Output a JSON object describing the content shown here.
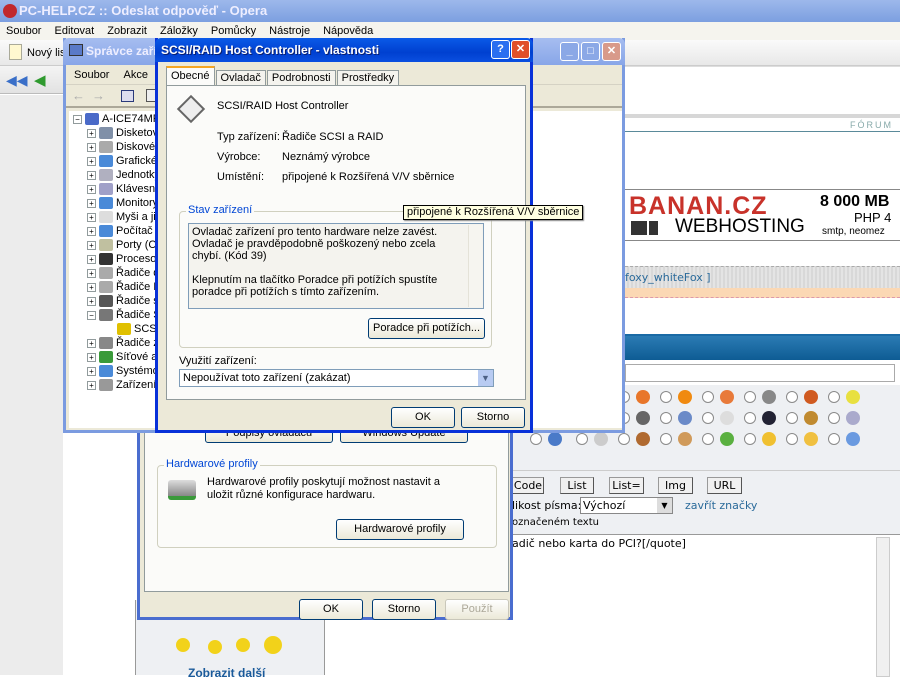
{
  "opera": {
    "title": "PC-HELP.CZ :: Odeslat odpověď - Opera",
    "menu": [
      "Soubor",
      "Editovat",
      "Zobrazit",
      "Záložky",
      "Pomůcky",
      "Nástroje",
      "Nápověda"
    ],
    "new_tab": "Nový list"
  },
  "webpage": {
    "forum_label": "FÓRUM",
    "banner": {
      "brand": "BANAN.CZ",
      "sub": "WEBHOSTING",
      "size": "8 000 MB",
      "php": "PHP 4",
      "smtp": "smtp, neomez"
    },
    "user_link": "foxy_whiteFox ]",
    "format_buttons": [
      "Code",
      "List",
      "List=",
      "Img",
      "URL"
    ],
    "font_size_label": "likost písma:",
    "font_size_value": "Výchozí",
    "close_tags": "zavřít značky",
    "selected_text_label": "označeném textu",
    "textarea_text": "adič nebo karta do PCI?[/quote]",
    "show_more": "Zobrazit další"
  },
  "devmgr": {
    "title": "Správce zaří",
    "menu": [
      "Soubor",
      "Akce"
    ],
    "root": "A-ICE74MRR",
    "items": [
      "Disketov",
      "Diskové",
      "Grafické",
      "Jednotky",
      "Klávesnic",
      "Monitory",
      "Myši a ji",
      "Počítač",
      "Porty (C",
      "Procesor",
      "Řadiče d",
      "Řadiče I",
      "Řadiče s",
      "Řadiče S",
      "SCSI",
      "Řadiče z",
      "Síťové a",
      "Systémo",
      "Zařízení"
    ]
  },
  "sysprops": {
    "btn_signing": "Podpisy ovladačů",
    "btn_update": "Windows Update",
    "hw_group": "Hardwarové profily",
    "hw_text": "Hardwarové profily poskytují možnost nastavit a uložit různé konfigurace hardwaru.",
    "hw_button": "Hardwarové profily",
    "ok": "OK",
    "cancel": "Storno",
    "apply": "Použít"
  },
  "dialog": {
    "title": "SCSI/RAID Host Controller - vlastnosti",
    "tabs": [
      "Obecné",
      "Ovladač",
      "Podrobnosti",
      "Prostředky"
    ],
    "device_name": "SCSI/RAID Host Controller",
    "type_label": "Typ zařízení:",
    "type_value": "Řadiče SCSI a RAID",
    "mfr_label": "Výrobce:",
    "mfr_value": "Neznámý výrobce",
    "loc_label": "Umístění:",
    "loc_value": "připojené k Rozšířená V/V sběrnice",
    "status_group": "Stav zařízení",
    "status_text1": "Ovladač zařízení pro tento hardware nelze zavést. Ovladač je pravděpodobně poškozený nebo zcela chybí. (Kód 39)",
    "status_text2": "Klepnutím na tlačítko Poradce při potížích spustíte poradce při potížích s tímto zařízením.",
    "troubleshoot": "Poradce při potížích...",
    "usage_label": "Využití zařízení:",
    "usage_value": "Nepoužívat toto zařízení (zakázat)",
    "ok": "OK",
    "cancel": "Storno",
    "tooltip": "připojené k Rozšířená V/V sběrnice"
  }
}
